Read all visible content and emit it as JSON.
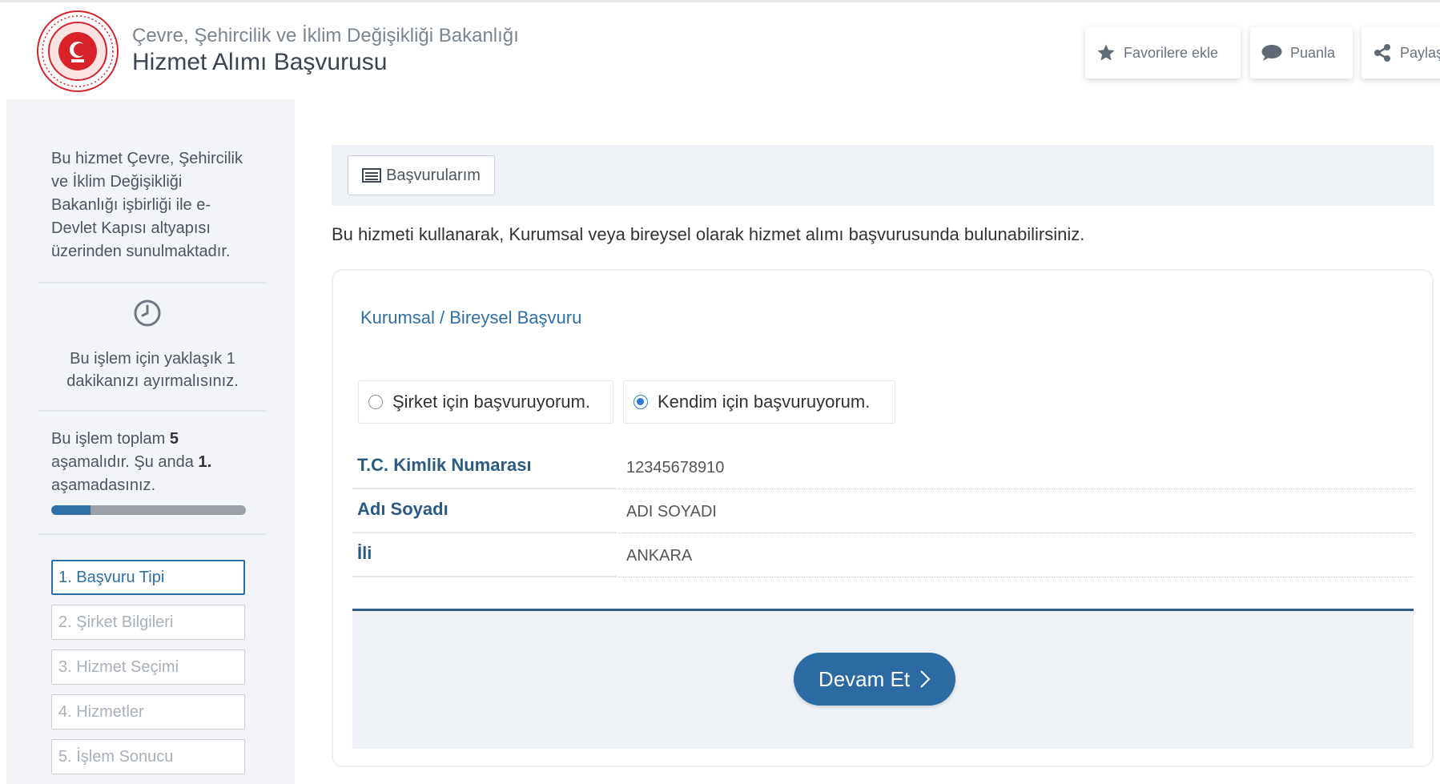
{
  "header": {
    "ministry": "Çevre, Şehircilik ve İklim Değişikliği Bakanlığı",
    "title": "Hizmet Alımı Başvurusu",
    "buttons": {
      "favorite": "Favorilere ekle",
      "rate": "Puanla",
      "share": "Paylaş"
    }
  },
  "sidebar": {
    "description": "Bu hizmet Çevre, Şehircilik ve İklim Değişikliği Bakanlığı işbirliği ile e-Devlet Kapısı altyapısı üzerinden sunulmaktadır.",
    "time_notice": "Bu işlem için yaklaşık 1 dakikanızı ayırmalısınız.",
    "steps_info": {
      "prefix": "Bu işlem toplam ",
      "total": "5",
      "middle": " aşamalıdır. Şu anda ",
      "current": "1.",
      "suffix": " aşamadasınız."
    },
    "progress_fraction": 0.2,
    "steps": [
      {
        "label": "1. Başvuru Tipi",
        "active": true
      },
      {
        "label": "2. Şirket Bilgileri",
        "active": false
      },
      {
        "label": "3. Hizmet Seçimi",
        "active": false
      },
      {
        "label": "4. Hizmetler",
        "active": false
      },
      {
        "label": "5. İşlem Sonucu",
        "active": false
      }
    ]
  },
  "main": {
    "applications_button": "Başvurularım",
    "intro": "Bu hizmeti kullanarak, Kurumsal veya bireysel olarak hizmet alımı başvurusunda bulunabilirsiniz.",
    "card_title": "Kurumsal / Bireysel Başvuru",
    "options": [
      {
        "label": "Şirket için başvuruyorum.",
        "selected": false
      },
      {
        "label": "Kendim için başvuruyorum.",
        "selected": true
      }
    ],
    "fields": [
      {
        "label": "T.C. Kimlik Numarası",
        "value": "12345678910"
      },
      {
        "label": "Adı Soyadı",
        "value": "ADI SOYADI"
      },
      {
        "label": "İli",
        "value": "ANKARA"
      }
    ],
    "continue_button": "Devam Et"
  },
  "colors": {
    "accent": "#2f6fa8",
    "button": "#2d6aa3",
    "label": "#2d5a82",
    "sidebar_bg": "#f2f4f7",
    "logo_red": "#d8232a"
  },
  "icons": {
    "favorite": "star-icon",
    "rate": "speech-bubble-icon",
    "share": "share-icon",
    "time": "clock-icon",
    "applications": "list-icon",
    "continue": "chevron-right-icon"
  }
}
